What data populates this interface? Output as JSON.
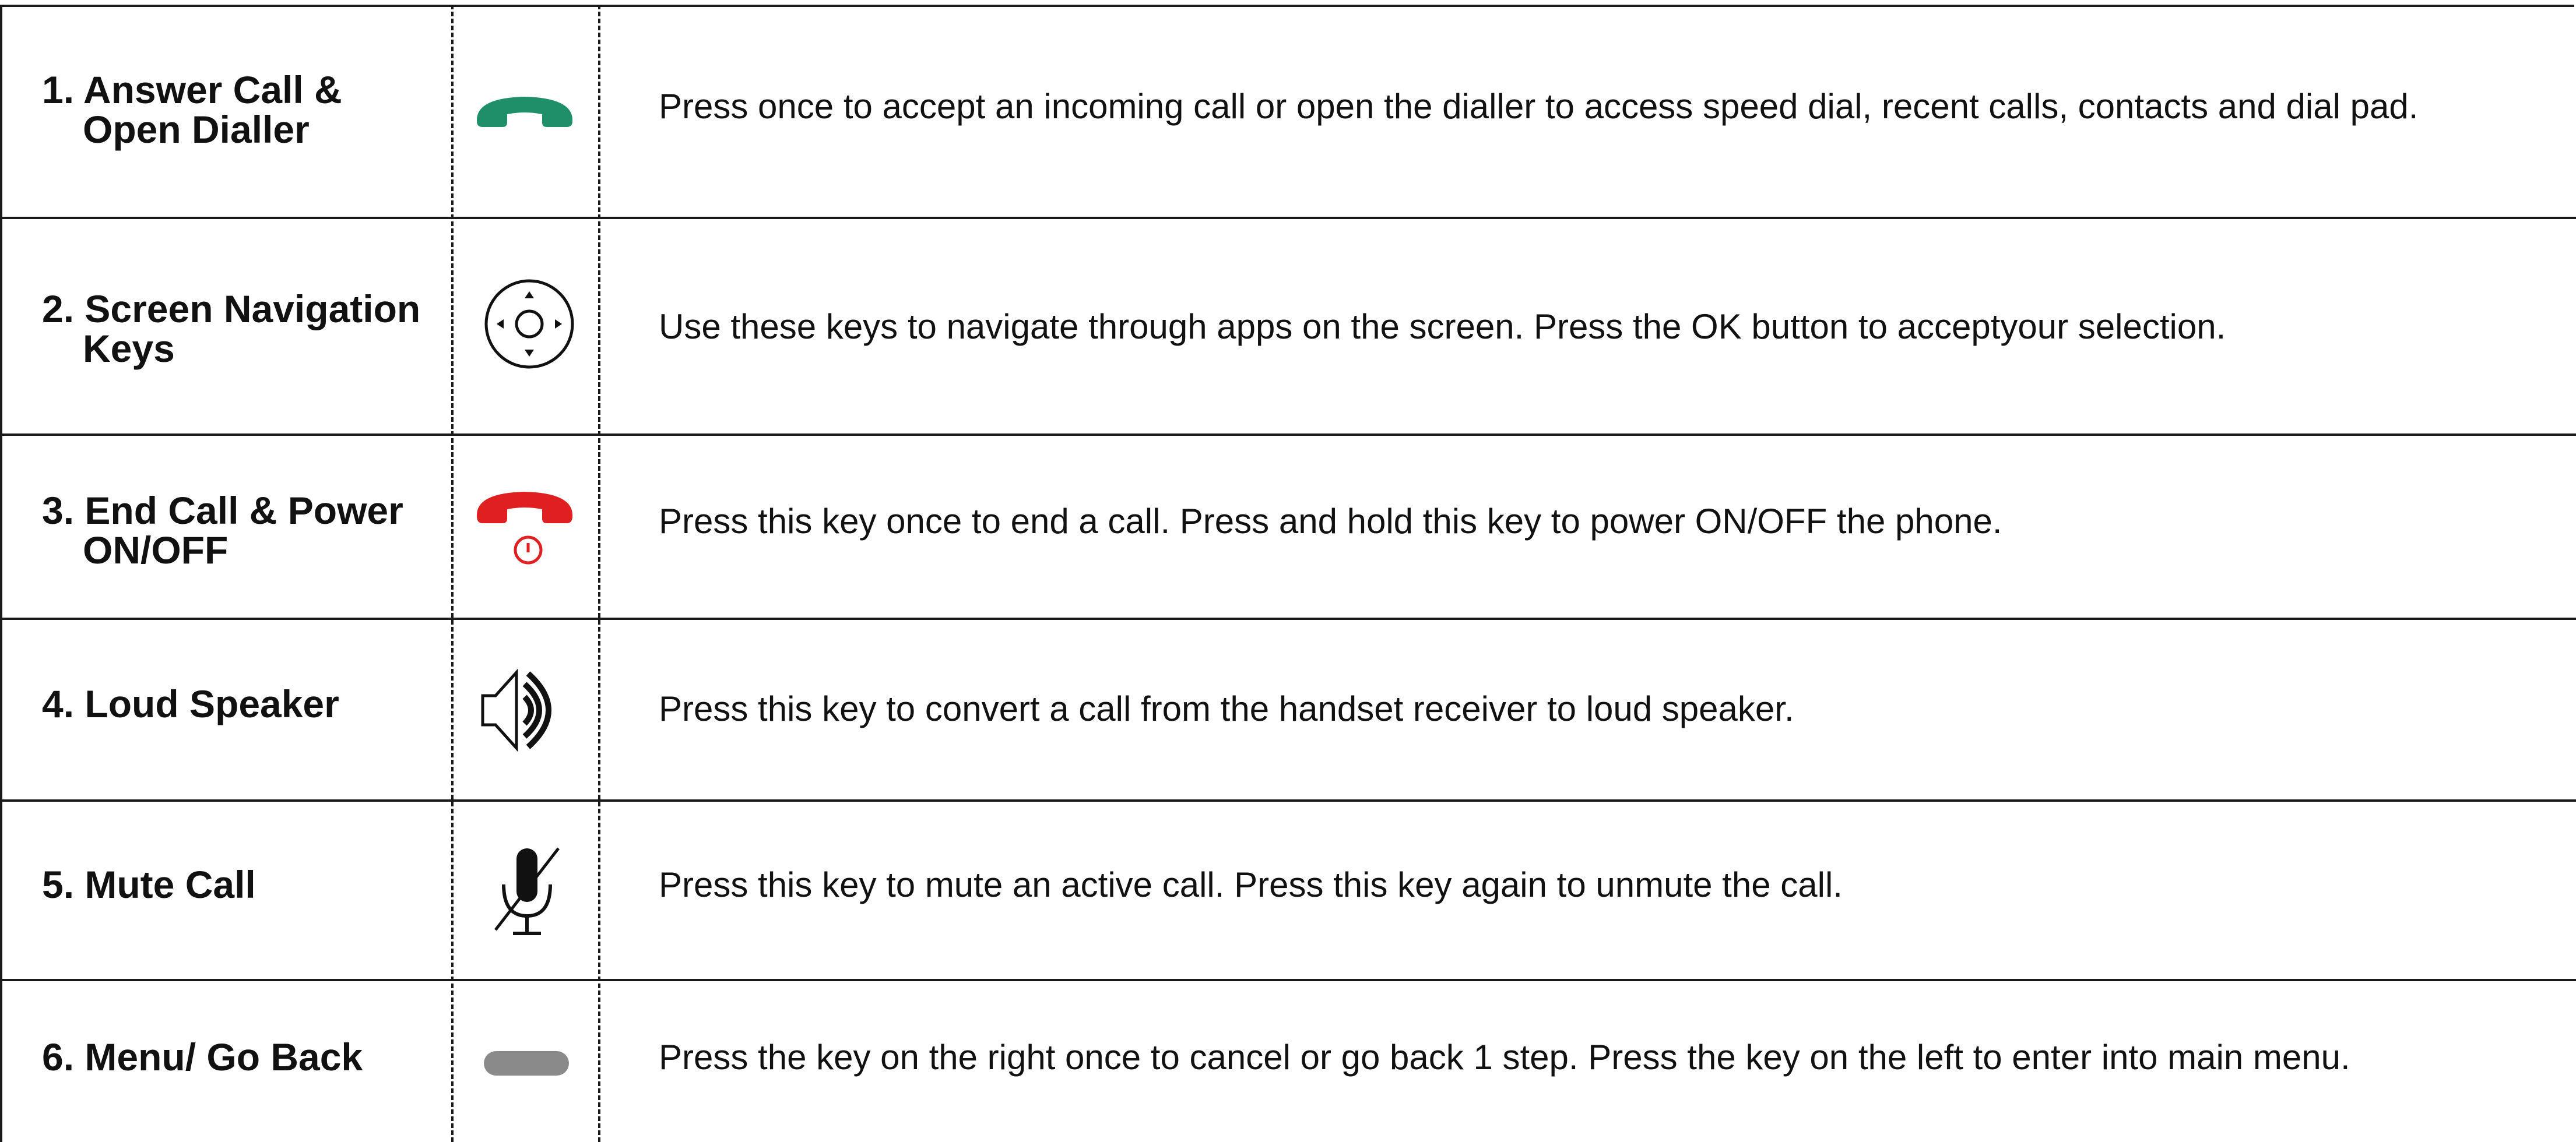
{
  "rows": [
    {
      "number": "1.",
      "title_line1": "1. Answer Call &",
      "title_line2": "Open Dialler",
      "icon": "phone-answer-icon",
      "icon_color": "#1f8f69",
      "description": "Press once to accept an incoming call or open the dialler to access speed dial, recent calls, contacts and dial pad."
    },
    {
      "number": "2.",
      "title_line1": "2. Screen Navigation",
      "title_line2": "Keys",
      "icon": "navigation-keys-icon",
      "icon_color": "#111111",
      "description": "Use these keys to navigate through apps on the screen. Press the OK button to acceptyour selection."
    },
    {
      "number": "3.",
      "title_line1": "3. End Call & Power",
      "title_line2": "ON/OFF",
      "icon": "phone-end-power-icon",
      "icon_color": "#e02020",
      "description": "Press this key once to end a call. Press and hold this key to power ON/OFF the phone."
    },
    {
      "number": "4.",
      "title_line1": "4. Loud Speaker",
      "title_line2": "",
      "icon": "speaker-icon",
      "icon_color": "#111111",
      "description": "Press this key to convert a call from the handset receiver to loud speaker."
    },
    {
      "number": "5.",
      "title_line1": "5. Mute Call",
      "title_line2": "",
      "icon": "mute-microphone-icon",
      "icon_color": "#111111",
      "description": "Press this key to mute an active call. Press this key again to unmute the call."
    },
    {
      "number": "6.",
      "title_line1": "6. Menu/ Go Back",
      "title_line2": "",
      "icon": "soft-key-icon",
      "icon_color": "#8a8a8a",
      "description": "Press the key on the right once to cancel or go back 1 step. Press the key on the left  to enter into main menu."
    }
  ]
}
